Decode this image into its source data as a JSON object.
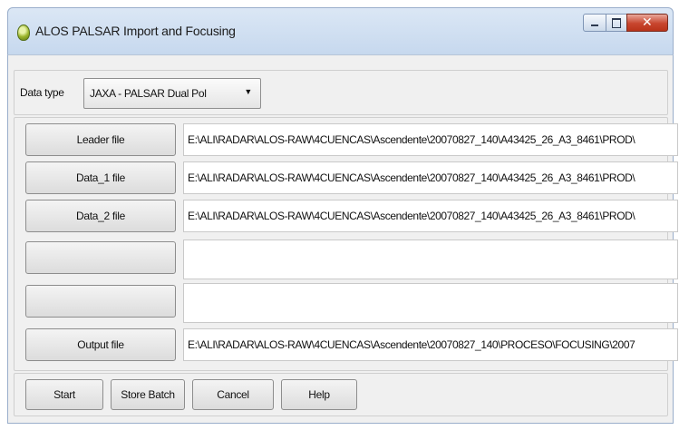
{
  "window": {
    "title": "ALOS PALSAR Import and Focusing"
  },
  "data_type": {
    "label": "Data type",
    "selected": "JAXA - PALSAR Dual Pol"
  },
  "files": [
    {
      "button": "Leader file",
      "path": "E:\\ALI\\RADAR\\ALOS-RAW\\4CUENCAS\\Ascendente\\20070827_140\\A43425_26_A3_8461\\PROD\\"
    },
    {
      "button": "Data_1 file",
      "path": "E:\\ALI\\RADAR\\ALOS-RAW\\4CUENCAS\\Ascendente\\20070827_140\\A43425_26_A3_8461\\PROD\\"
    },
    {
      "button": "Data_2 file",
      "path": "E:\\ALI\\RADAR\\ALOS-RAW\\4CUENCAS\\Ascendente\\20070827_140\\A43425_26_A3_8461\\PROD\\"
    },
    {
      "button": "",
      "path": ""
    },
    {
      "button": "",
      "path": ""
    },
    {
      "button": "Output file",
      "path": "E:\\ALI\\RADAR\\ALOS-RAW\\4CUENCAS\\Ascendente\\20070827_140\\PROCESO\\FOCUSING\\2007"
    }
  ],
  "actions": {
    "start": "Start",
    "store_batch": "Store Batch",
    "cancel": "Cancel",
    "help": "Help"
  }
}
